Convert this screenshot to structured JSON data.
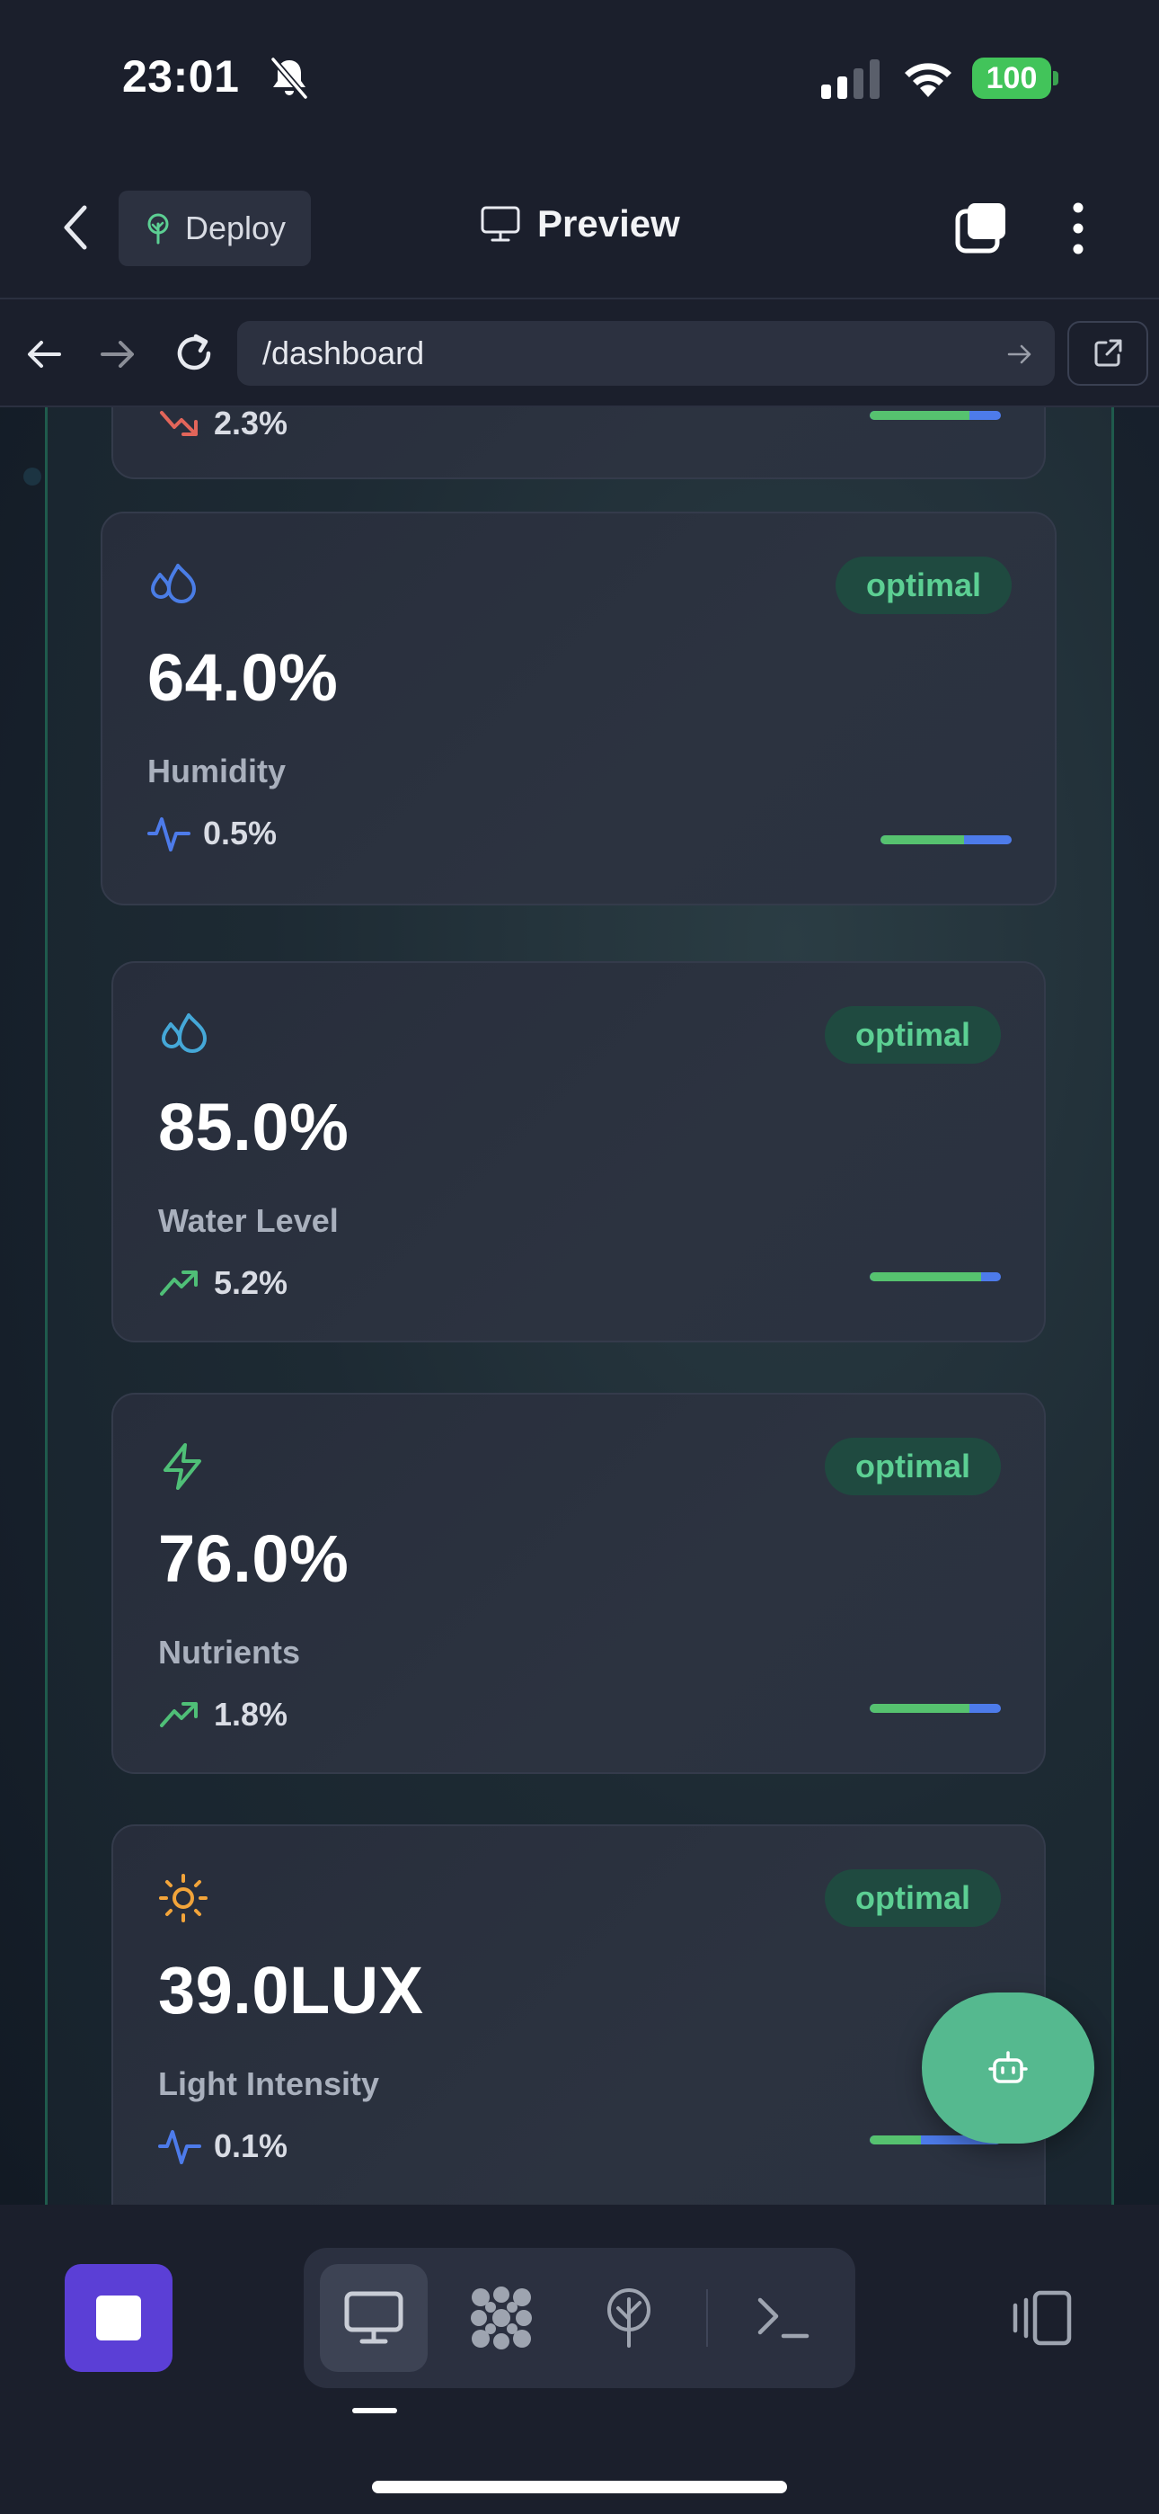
{
  "status_bar": {
    "time": "23:01",
    "battery": "100",
    "icons": [
      "bell-muted-icon",
      "signal-icon",
      "wifi-icon",
      "battery-icon"
    ]
  },
  "header": {
    "deploy_label": "Deploy",
    "title": "Preview",
    "icons": [
      "back-chevron-icon",
      "tree-icon",
      "monitor-icon",
      "tabs-icon",
      "more-vertical-icon"
    ]
  },
  "browser": {
    "url": "/dashboard",
    "icons": [
      "arrow-left-icon",
      "arrow-right-icon",
      "reload-icon",
      "arrow-right-small-icon",
      "external-link-icon"
    ]
  },
  "cards": [
    {
      "icon": "drop-partial-icon",
      "trend_text": "2.3%",
      "trend_icon": "trending-down-icon",
      "progress": 0.76
    },
    {
      "icon": "droplets-icon",
      "icon_color": "#4a7de6",
      "status": "optimal",
      "value": "64.0%",
      "label": "Humidity",
      "trend_text": "0.5%",
      "trend_icon": "activity-icon",
      "progress": 0.64
    },
    {
      "icon": "droplets-icon",
      "icon_color": "#45a8d8",
      "status": "optimal",
      "value": "85.0%",
      "label": "Water Level",
      "trend_text": "5.2%",
      "trend_icon": "trending-up-icon",
      "progress": 0.85
    },
    {
      "icon": "zap-icon",
      "icon_color": "#4fbf77",
      "status": "optimal",
      "value": "76.0%",
      "label": "Nutrients",
      "trend_text": "1.8%",
      "trend_icon": "trending-up-icon",
      "progress": 0.76
    },
    {
      "icon": "sun-icon",
      "icon_color": "#f2a43a",
      "status": "optimal",
      "value": "39.0LUX",
      "label": "Light Intensity",
      "trend_text": "0.1%",
      "trend_icon": "activity-icon",
      "progress": 0.39
    }
  ],
  "fab": {
    "icon": "bot-icon",
    "color": "#55b98f"
  },
  "toolbar": {
    "stop_color": "#5b3fd6",
    "modes": [
      "monitor-icon",
      "grid-dots-icon",
      "deploy-tree-icon",
      "terminal-icon"
    ],
    "active_mode": "monitor-icon",
    "layout_icon": "device-layout-icon"
  },
  "colors": {
    "background": "#1b1f2c",
    "badge_text": "#5ccf93",
    "bar_green": "#56c26f",
    "bar_blue": "#4d7bea",
    "trend_down": "#e2655a",
    "trend_up": "#4fbf77",
    "activity": "#4d7bea"
  }
}
